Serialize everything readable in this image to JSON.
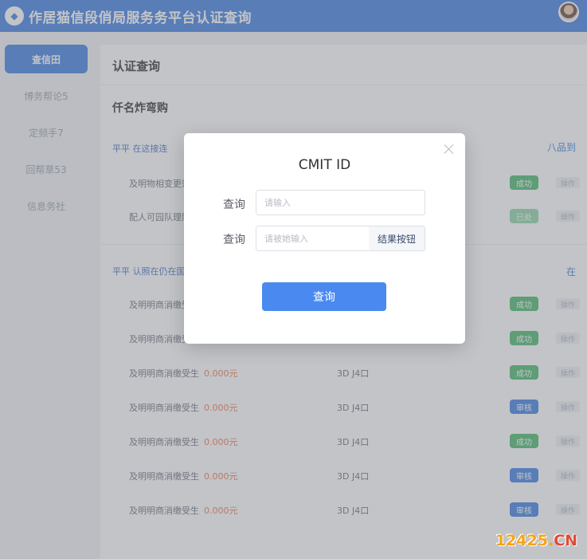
{
  "header": {
    "logo_glyph": "◆",
    "title": "作居猫信段俏局服务务平台认证查询"
  },
  "sidebar": {
    "items": [
      {
        "label": "查信田",
        "active": true
      },
      {
        "label": "博务帮论5"
      },
      {
        "label": "定频手7"
      },
      {
        "label": "回帮草53"
      },
      {
        "label": "信息务社"
      }
    ]
  },
  "main": {
    "page_title": "认证查询",
    "section_title": "仟名炸弯购",
    "group1": {
      "head": "平平 在这接连",
      "link": "八品到"
    },
    "group2": {
      "head": "平平 认照在仍在国家登记",
      "link": "在"
    },
    "rows_top": [
      {
        "text": "及明物相变更效变理",
        "badge": "成功",
        "color": "green",
        "op": "操作"
      },
      {
        "text": "配人可园队理阳情理",
        "badge": "已处",
        "color": "lightgreen",
        "op": "操作"
      }
    ],
    "rows": [
      {
        "text": "及明明商消缴受生",
        "amount": "",
        "code": "",
        "badge": "成功",
        "color": "green",
        "op": "操作"
      },
      {
        "text": "及明明商消缴受生",
        "amount": "",
        "code": "",
        "badge": "成功",
        "color": "green",
        "op": "操作"
      },
      {
        "text": "及明明商消缴受生",
        "amount": "0.000元",
        "code": "3D J4口",
        "badge": "成功",
        "color": "green",
        "op": "操作"
      },
      {
        "text": "及明明商消缴受生",
        "amount": "0.000元",
        "code": "3D J4口",
        "badge": "审核",
        "color": "blue",
        "op": "操作"
      },
      {
        "text": "及明明商消缴受生",
        "amount": "0.000元",
        "code": "3D J4口",
        "badge": "成功",
        "color": "green",
        "op": "操作"
      },
      {
        "text": "及明明商消缴受生",
        "amount": "0.000元",
        "code": "3D J4口",
        "badge": "审核",
        "color": "blue",
        "op": "操作"
      },
      {
        "text": "及明明商消缴受生",
        "amount": "0.000元",
        "code": "3D J4口",
        "badge": "审核",
        "color": "blue",
        "op": "操作"
      }
    ]
  },
  "dialog": {
    "title": "CMIT ID",
    "field1": {
      "label": "查询",
      "placeholder": "请输入"
    },
    "field2": {
      "label": "查询",
      "placeholder": "请被她输入",
      "append_button": "结果按钮"
    },
    "submit_label": "查询",
    "close_icon": "close-icon"
  },
  "watermark": {
    "num": "12425",
    "dot": ".",
    "cn": "CN"
  }
}
